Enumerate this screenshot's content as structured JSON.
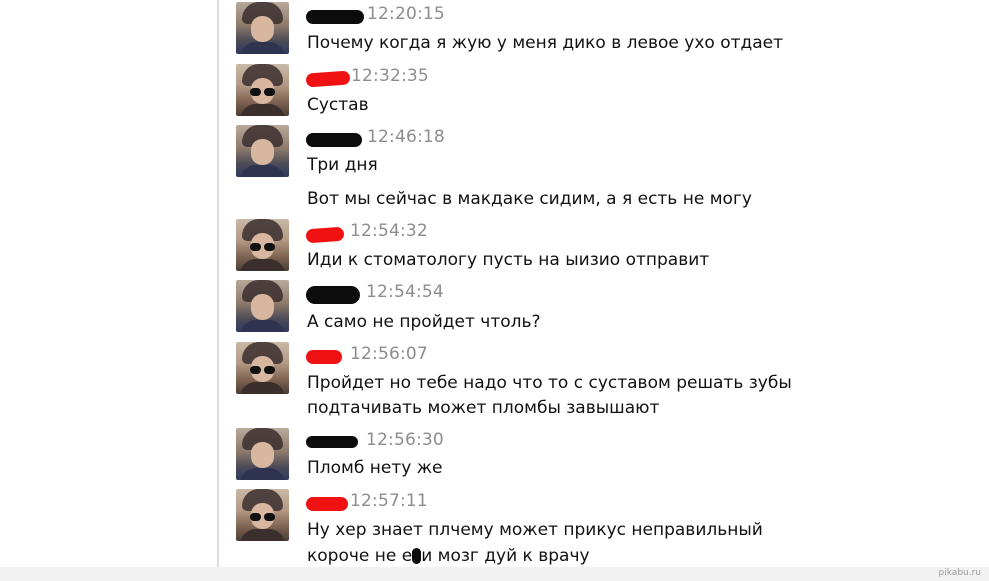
{
  "messages": [
    {
      "author": "boy",
      "time": "12:20:15",
      "lines": [
        "Почему когда я жую у меня дико в левое ухо отдает"
      ]
    },
    {
      "author": "girl",
      "time": "12:32:35",
      "lines": [
        "Сустав"
      ]
    },
    {
      "author": "boy",
      "time": "12:46:18",
      "lines": [
        "Три дня",
        "Вот мы сейчас в макдаке сидим, а я есть не могу"
      ]
    },
    {
      "author": "girl",
      "time": "12:54:32",
      "lines": [
        "Иди к стоматологу пусть на ыизио отправит"
      ]
    },
    {
      "author": "boy",
      "time": "12:54:54",
      "lines": [
        "А само не пройдет чтоль?"
      ]
    },
    {
      "author": "girl",
      "time": "12:56:07",
      "lines": [
        "Пройдет но тебе надо что то с суставом решать зубы",
        "подтачивать может пломбы завышают"
      ]
    },
    {
      "author": "boy",
      "time": "12:56:30",
      "lines": [
        "Пломб нету же"
      ]
    },
    {
      "author": "girl",
      "time": "12:57:11",
      "lines": [
        "Ну хер знает плчему может прикус неправильный",
        "короче не е",
        "и мозг дуй к врачу"
      ]
    }
  ],
  "watermark": "pikabu.ru",
  "colors": {
    "redact_black": "#0c0c0c",
    "redact_red": "#f01212",
    "time": "#8d8d8d"
  }
}
